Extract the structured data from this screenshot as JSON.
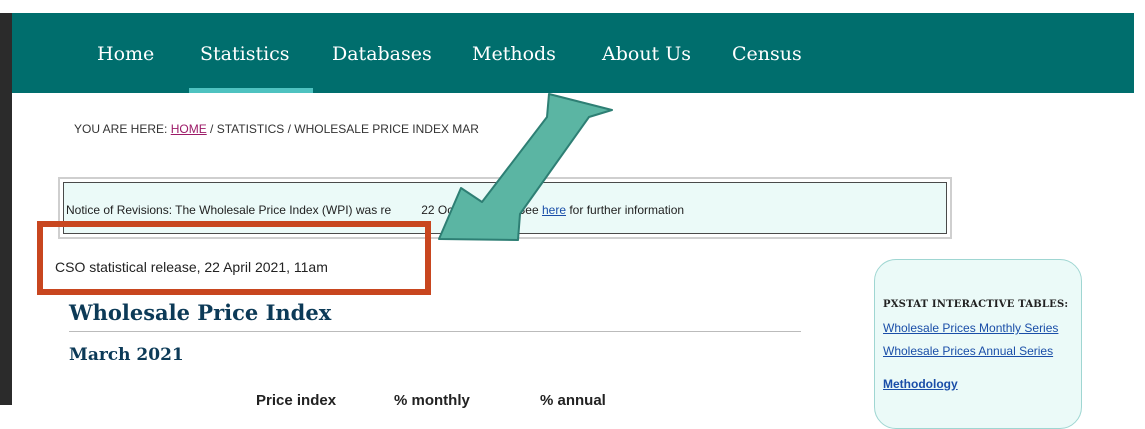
{
  "nav": {
    "items": [
      {
        "label": "Home"
      },
      {
        "label": "Statistics"
      },
      {
        "label": "Databases"
      },
      {
        "label": "Methods"
      },
      {
        "label": "About Us"
      },
      {
        "label": "Census"
      }
    ],
    "active": "Statistics"
  },
  "breadcrumb": {
    "prefix": "YOU ARE HERE: ",
    "home": "HOME",
    "rest": " / STATISTICS / WHOLESALE PRICE INDEX MAR"
  },
  "notice": {
    "before": "Notice of Revisions: The Wholesale Price Index (WPI) was re",
    "middle": "22 October 2020. See ",
    "link": "here",
    "after": " for further information"
  },
  "release": {
    "text": "CSO statistical release, 22 April 2021, 11am"
  },
  "article": {
    "title": "Wholesale Price Index",
    "subtitle": "March 2021",
    "columns": [
      "Price index",
      "% monthly",
      "% annual"
    ]
  },
  "sidebar": {
    "heading": "PXSTAT INTERACTIVE TABLES:",
    "links": [
      "Wholesale Prices Monthly Series",
      "Wholesale Prices Annual Series"
    ],
    "methodology": "Methodology"
  },
  "colors": {
    "navbar": "#006e6d",
    "nav_active_underline": "#4ec2c0",
    "heading": "#0c3a57",
    "link": "#1a4ea8",
    "home_link": "#9c1a67",
    "annotation_box": "#c8461f",
    "annotation_arrow": "#5bb5a3",
    "panel_background": "#ebfaf8"
  }
}
